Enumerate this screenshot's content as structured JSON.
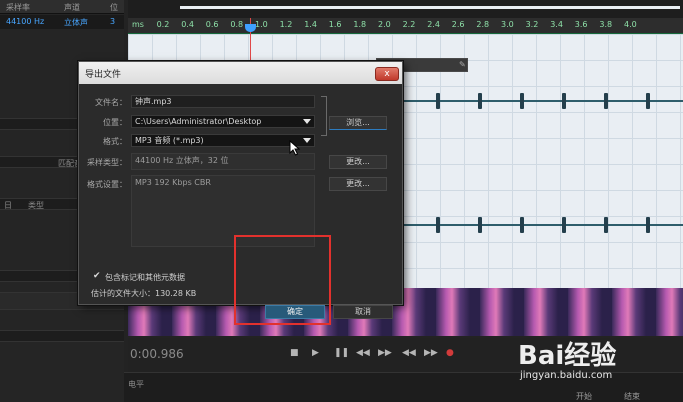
{
  "left_panel": {
    "header_col1": "采样率",
    "header_col2": "声道",
    "header_col3": "位",
    "row_rate": "44100 Hz",
    "row_channel": "立体声",
    "row_bits": "3",
    "match_volume": "匹配音量",
    "col_type": "类型",
    "col_ri": "日"
  },
  "timeline": {
    "ticks": [
      "ms",
      "0.2",
      "0.4",
      "0.6",
      "0.8",
      "1.0",
      "1.2",
      "1.4",
      "1.6",
      "1.8",
      "2.0",
      "2.2",
      "2.4",
      "2.6",
      "2.8",
      "3.0",
      "3.2",
      "3.4",
      "3.6",
      "3.8",
      "4.0"
    ]
  },
  "transport": {
    "time": "0:00.986",
    "buttons": [
      "■",
      "▶",
      "❚❚",
      "◀◀",
      "▶▶",
      "◀◀",
      "▶▶",
      "●"
    ]
  },
  "bottom_bar": {
    "label_left": "电平",
    "label_start": "开始",
    "label_end": "结束"
  },
  "dialog": {
    "title": "导出文件",
    "close_label": "x",
    "filename_label": "文件名：",
    "filename_value": "钟声.mp3",
    "location_label": "位置：",
    "location_value": "C:\\Users\\Administrator\\Desktop",
    "browse_label": "浏览...",
    "format_label": "格式：",
    "format_value": "MP3 音频 (*.mp3)",
    "sample_type_label": "采样类型：",
    "sample_type_value": "44100 Hz 立体声，32 位",
    "change1_label": "更改...",
    "format_settings_label": "格式设置：",
    "format_settings_value": "MP3 192 Kbps CBR",
    "change2_label": "更改...",
    "checkbox_mark": "✔",
    "include_markers_label": "包含标记和其他元数据",
    "estimated_size_label": "估计的文件大小：130.28 KB",
    "ok_label": "确定",
    "cancel_label": "取消"
  },
  "watermark": {
    "brand": "Bai经验",
    "url": "jingyan.baidu.com"
  },
  "colors": {
    "accent_blue": "#48a6ff",
    "ok_button": "#275a7a",
    "annotation_red": "#e2312d"
  }
}
